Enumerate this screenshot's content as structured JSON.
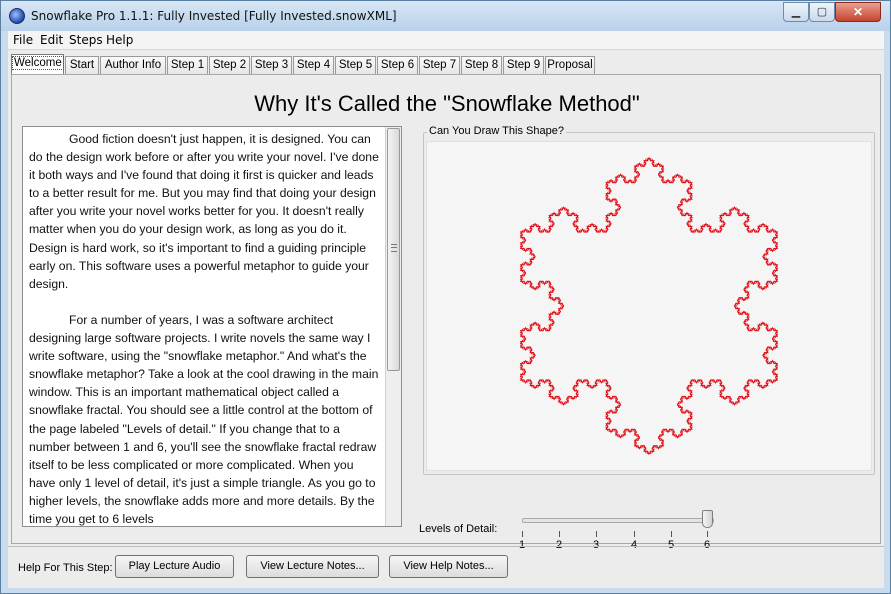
{
  "window": {
    "title": "Snowflake Pro 1.1.1: Fully Invested  [Fully Invested.snowXML]",
    "min_glyph": "▁",
    "max_glyph": "▢",
    "close_glyph": "✕"
  },
  "menu": [
    "File",
    "Edit",
    "Steps",
    "Help"
  ],
  "tabs": [
    "Welcome",
    "Start",
    "Author Info",
    "Step 1",
    "Step 2",
    "Step 3",
    "Step 4",
    "Step 5",
    "Step 6",
    "Step 7",
    "Step 8",
    "Step 9",
    "Proposal"
  ],
  "active_tab": "Welcome",
  "page": {
    "heading": "Why It's Called the \"Snowflake Method\"",
    "paragraphs": [
      "Good fiction doesn't just happen, it is designed. You can do the design work before or after you write your novel. I've done it both ways and I've found that doing it first is quicker and leads to a better result for me. But you may find that doing your design after you write your novel works better for you. It doesn't really matter when you do your design work, as long as you do it. Design is hard work, so it's important to find a guiding principle early on. This software uses a powerful metaphor to guide your design.",
      "For a number of years, I was a software architect designing large software projects. I write novels the same way I write software, using the \"snowflake metaphor.\" And what's the snowflake metaphor? Take a look at the cool drawing in the main window. This is an important mathematical object called a snowflake fractal. You should see a little control at the bottom of the page labeled \"Levels of detail.\" If you change that to a number between 1 and 6, you'll see the snowflake fractal redraw itself to be less complicated or more complicated. When you have only 1 level of detail, it's just a simple triangle. As you go to higher levels, the snowflake adds more and more details. By the time you get to 6 levels"
    ],
    "shape_group_label": "Can You Draw This Shape?",
    "snowflake_color": "#e0141c",
    "levels_label": "Levels of Detail:",
    "levels_ticks": [
      "1",
      "2",
      "3",
      "4",
      "5",
      "6"
    ],
    "levels_value": 6
  },
  "help_bar": {
    "label": "Help For This Step:",
    "play_audio": "Play Lecture Audio",
    "lecture_notes": "View Lecture Notes...",
    "help_notes": "View Help Notes..."
  },
  "colors": {
    "window_frame": "#c9dcee",
    "panel": "#ececec",
    "close_button": "#c7432d"
  }
}
